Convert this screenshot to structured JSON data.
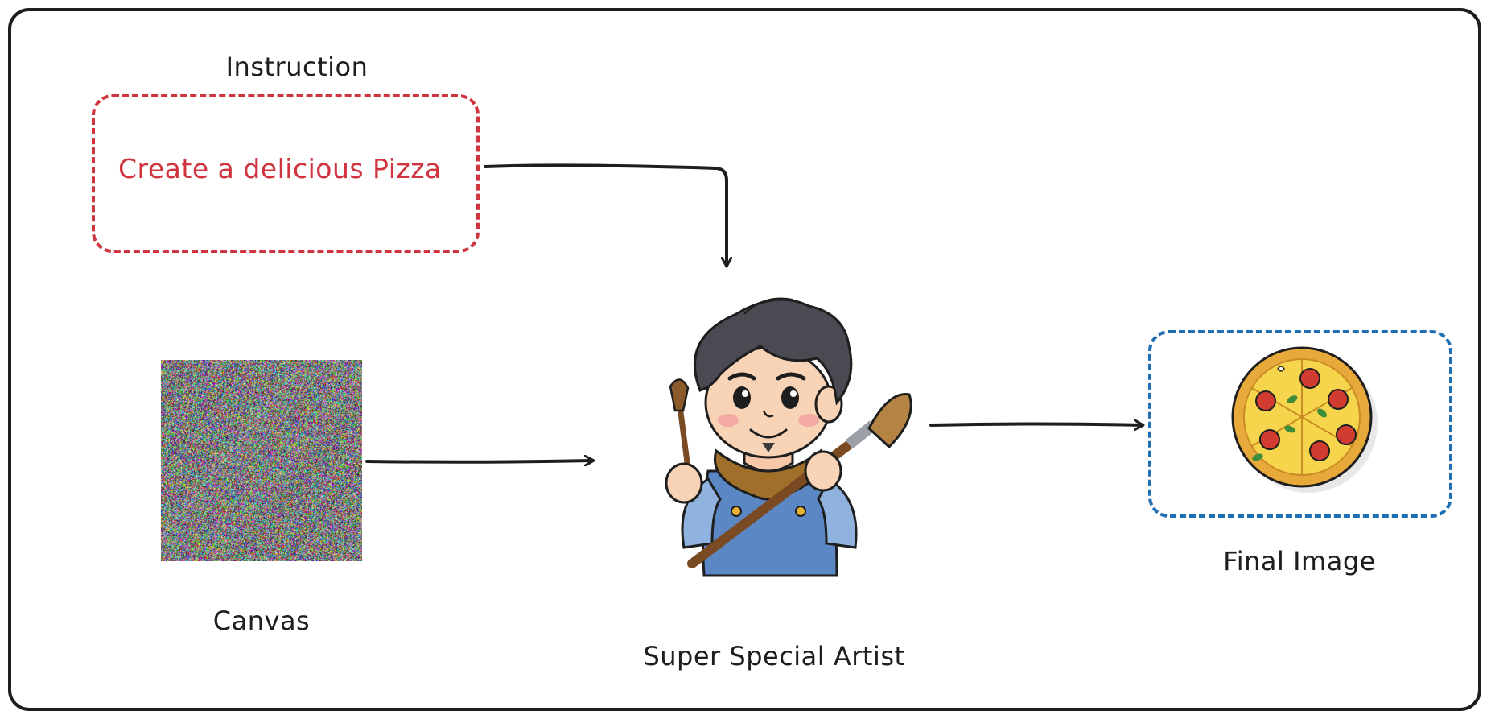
{
  "instruction": {
    "title": "Instruction",
    "text": "Create a delicious Pizza"
  },
  "canvas": {
    "label": "Canvas"
  },
  "artist": {
    "label": "Super Special Artist"
  },
  "output": {
    "label": "Final Image"
  },
  "colors": {
    "stroke": "#1e1e1e",
    "instruction_accent": "#d0343f",
    "output_accent": "#1f6fb5"
  },
  "icons": {
    "noise": "random-noise-canvas",
    "artist": "artist-with-paintbrushes-illustration",
    "pizza": "pizza-icon"
  }
}
